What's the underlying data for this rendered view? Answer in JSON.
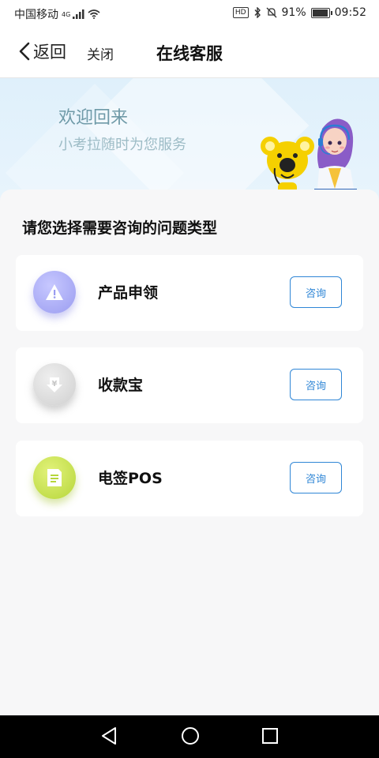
{
  "status_bar": {
    "carrier": "中国移动",
    "network": "4G",
    "hd_badge": "HD",
    "battery": "91%",
    "time": "09:52"
  },
  "nav": {
    "back_label": "返回",
    "close_label": "关闭",
    "title": "在线客服"
  },
  "banner": {
    "title": "欢迎回来",
    "subtitle": "小考拉随时为您服务"
  },
  "section_title": "请您选择需要咨询的问题类型",
  "options": [
    {
      "label": "产品申领",
      "button": "咨询",
      "icon": "warning-icon",
      "color": "#a8a9f5"
    },
    {
      "label": "收款宝",
      "button": "咨询",
      "icon": "yuan-download-icon",
      "color": "#d4d4d4"
    },
    {
      "label": "电签POS",
      "button": "咨询",
      "icon": "document-icon",
      "color": "#c8e255"
    }
  ],
  "colors": {
    "accent": "#2f86d6",
    "banner_bg": "#e0f0fb"
  }
}
